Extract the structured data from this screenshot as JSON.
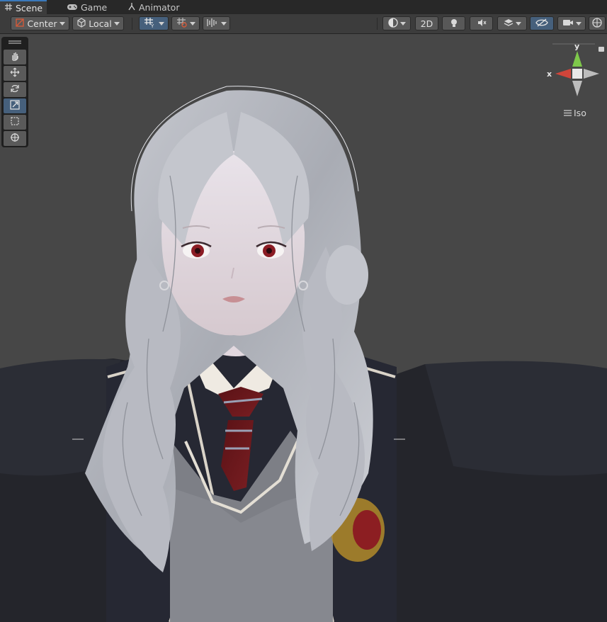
{
  "tabs": [
    {
      "label": "Scene",
      "icon": "grid-icon",
      "active": true
    },
    {
      "label": "Game",
      "icon": "gamepad-icon",
      "active": false
    },
    {
      "label": "Animator",
      "icon": "animator-icon",
      "active": false
    }
  ],
  "toolbar": {
    "pivot_label": "Center",
    "space_label": "Local",
    "mode_2d_label": "2D"
  },
  "gizmo": {
    "y_label": "y",
    "x_label": "x",
    "projection_label": "Iso"
  },
  "colors": {
    "accent": "#3a79bb",
    "selected_button": "#46607c",
    "viewport_bg": "#474747",
    "toolbar_bg": "#3c3c3c",
    "x_axis": "#d0453a",
    "y_axis": "#7ec84a"
  },
  "tools": [
    {
      "name": "hand-tool",
      "icon": "hand-icon",
      "selected": false
    },
    {
      "name": "move-tool",
      "icon": "move-icon",
      "selected": false
    },
    {
      "name": "rotate-tool",
      "icon": "rotate-icon",
      "selected": false
    },
    {
      "name": "scale-tool",
      "icon": "scale-icon",
      "selected": true
    },
    {
      "name": "rect-tool",
      "icon": "rect-icon",
      "selected": false
    },
    {
      "name": "transform-tool",
      "icon": "transform-icon",
      "selected": false
    }
  ]
}
